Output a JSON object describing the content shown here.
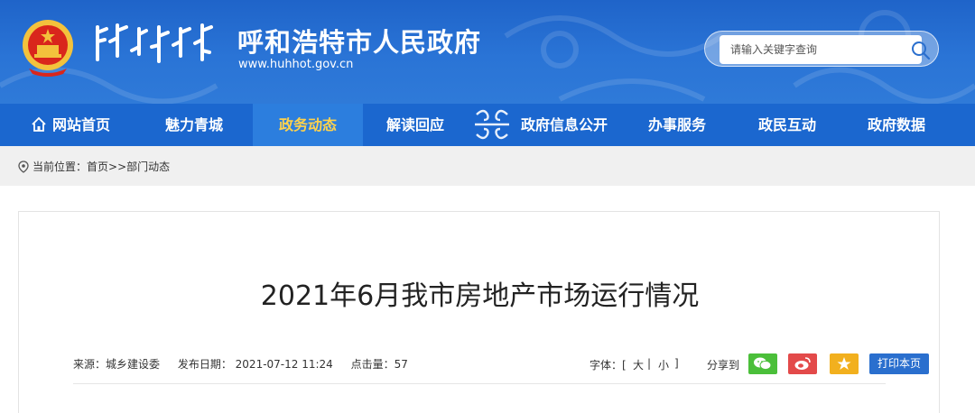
{
  "header": {
    "site_title": "呼和浩特市人民政府",
    "site_url": "www.huhhot.gov.cn",
    "search_placeholder": "请输入关键字查询",
    "emblem_icon": "national-emblem-icon",
    "mongolian_script": "mongolian-script-logo"
  },
  "nav": {
    "items": [
      {
        "label": "网站首页",
        "icon": "home-icon"
      },
      {
        "label": "魅力青城"
      },
      {
        "label": "政务动态",
        "active": true
      },
      {
        "label": "解读回应"
      },
      {
        "label": "政府信息公开"
      },
      {
        "label": "办事服务"
      },
      {
        "label": "政民互动"
      },
      {
        "label": "政府数据"
      }
    ]
  },
  "breadcrumb": {
    "prefix": "当前位置：",
    "home": "首页",
    "sep": ">>",
    "current": "部门动态"
  },
  "article": {
    "title": "2021年6月我市房地产市场运行情况",
    "source": "来源：城乡建设委",
    "date": "发布日期：  2021-07-12 11:24",
    "hits": "点击量：57",
    "font_label": "字体：[",
    "font_big": "大",
    "font_sep": "|",
    "font_small": "小",
    "font_end": "]",
    "share_label": "分享到",
    "share": [
      {
        "icon": "wechat-icon",
        "color": "#4bbf3a"
      },
      {
        "icon": "weibo-icon",
        "color": "#e34a4a"
      },
      {
        "icon": "favorite-star-icon",
        "color": "#f2b01e"
      }
    ],
    "print_label": "打印本页"
  },
  "colors": {
    "header_blue": "#2a74d6",
    "nav_blue": "#1b67cf",
    "nav_active_text": "#ffd24c",
    "print_blue": "#2a6fce"
  }
}
